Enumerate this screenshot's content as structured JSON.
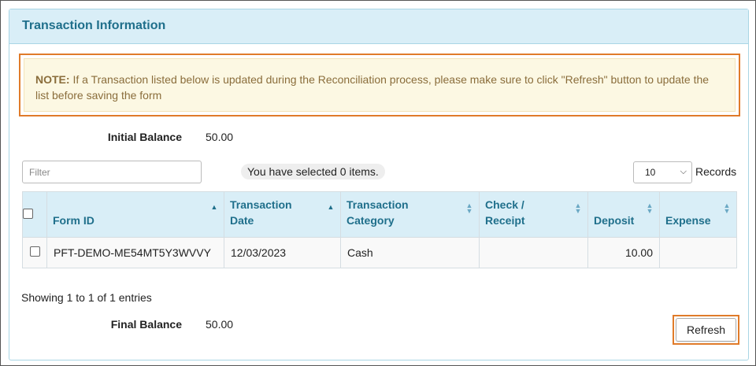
{
  "panel": {
    "title": "Transaction Information"
  },
  "note": {
    "label": "NOTE:",
    "text": " If a Transaction listed below is updated during the Reconciliation process, please make sure to click \"Refresh\" button to update the list before saving the form"
  },
  "initial_balance": {
    "label": "Initial Balance",
    "value": "50.00"
  },
  "filter": {
    "placeholder": "Filter",
    "value": ""
  },
  "selection": {
    "text": "You have selected 0 items."
  },
  "records": {
    "selected": "10",
    "label": "Records"
  },
  "table": {
    "columns": [
      {
        "label": "Form ID",
        "sort": "asc"
      },
      {
        "label": "Transaction Date",
        "sort": "asc"
      },
      {
        "label": "Transaction Category",
        "sort": "both"
      },
      {
        "label": "Check / Receipt",
        "sort": "both"
      },
      {
        "label": "Deposit",
        "sort": "both"
      },
      {
        "label": "Expense",
        "sort": "both"
      }
    ],
    "rows": [
      {
        "form_id": "PFT-DEMO-ME54MT5Y3WVVY",
        "date": "12/03/2023",
        "category": "Cash",
        "check_receipt": "",
        "deposit": "10.00",
        "expense": ""
      }
    ]
  },
  "showing": "Showing 1 to 1 of 1 entries",
  "final_balance": {
    "label": "Final Balance",
    "value": "50.00"
  },
  "refresh": {
    "label": "Refresh"
  },
  "colors": {
    "accent": "#1f6f8b",
    "header_bg": "#d9eef7",
    "highlight": "#e07b2a",
    "note_bg": "#fcf8e3"
  }
}
